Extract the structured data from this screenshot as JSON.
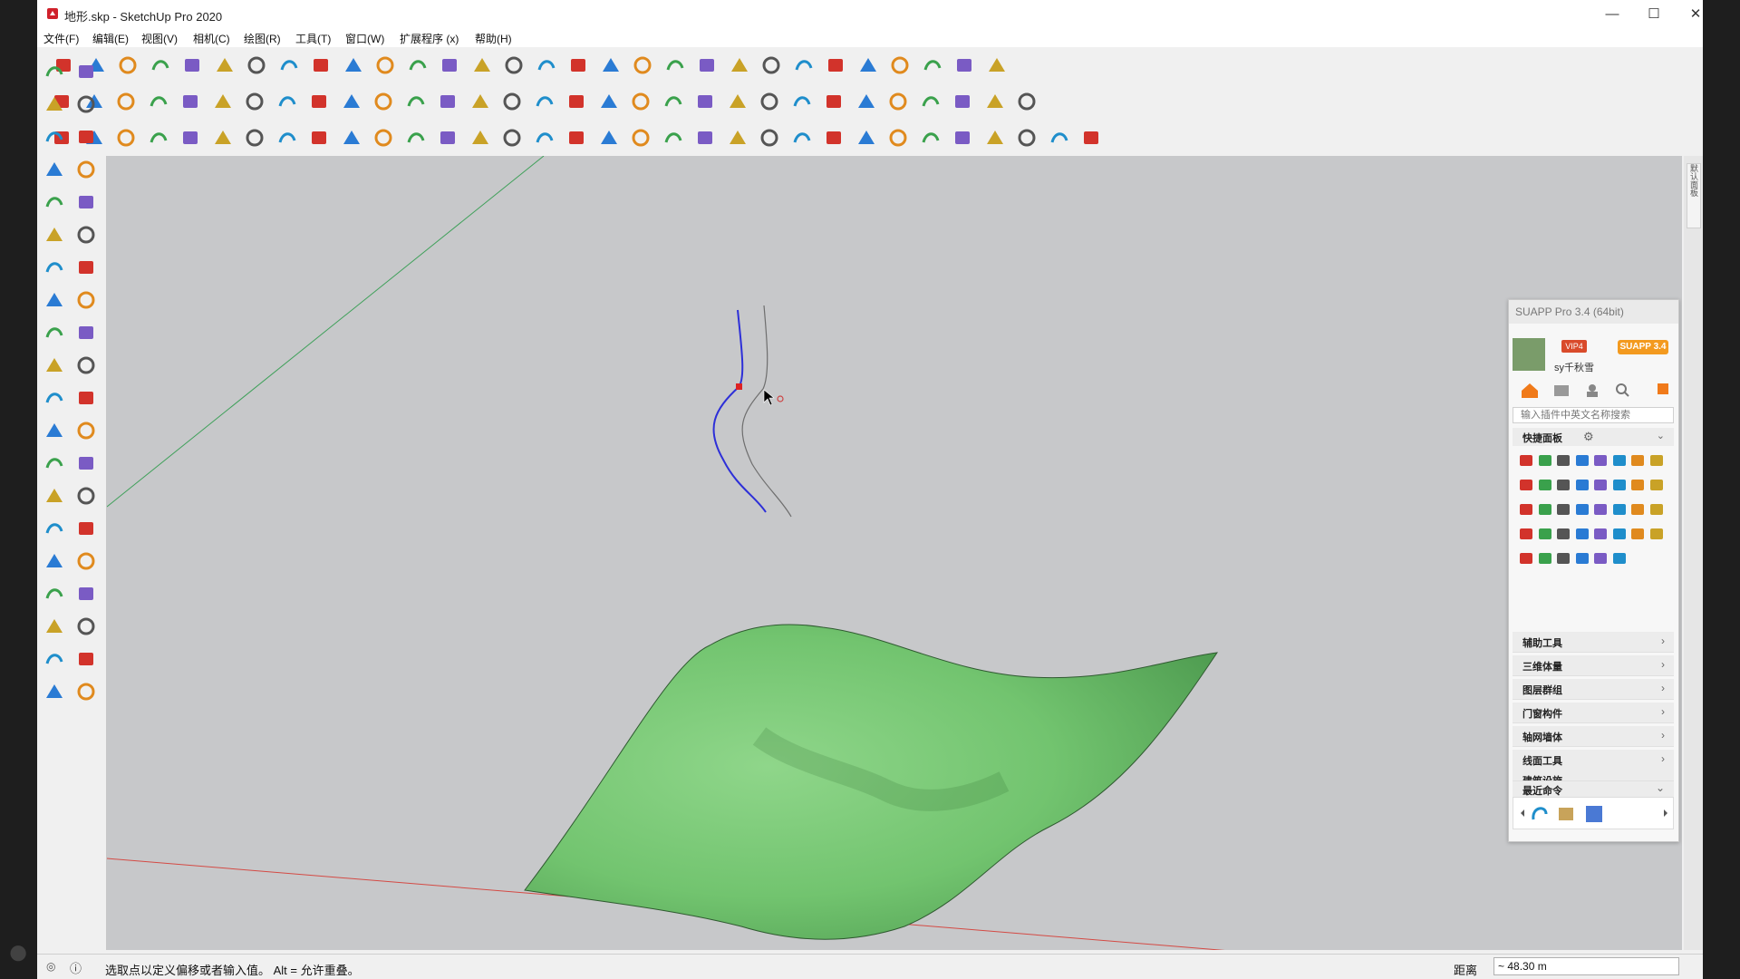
{
  "window": {
    "title": "地形.skp - SketchUp Pro 2020",
    "minimize": "—",
    "maximize": "☐",
    "close": "✕"
  },
  "menu": [
    "文件(F)",
    "编辑(E)",
    "视图(V)",
    "相机(C)",
    "绘图(R)",
    "工具(T)",
    "窗口(W)",
    "扩展程序 (x)",
    "帮助(H)"
  ],
  "toolbars": {
    "row1": [
      "new",
      "open",
      "save",
      "cut",
      "copy",
      "paste",
      "erase",
      "undo",
      "redo",
      "print",
      "model-info",
      "x-ray",
      "back-edges",
      "wireframe",
      "hidden-line",
      "shaded",
      "textured",
      "iso",
      "top",
      "front",
      "right",
      "back",
      "left",
      "bottom",
      "section",
      "section-fill",
      "section-cut",
      "display-sections",
      "sun",
      "scenes"
    ],
    "row2": [
      "push-pull",
      "offset",
      "follow-me",
      "sandbox",
      "texture",
      "eraser",
      "rotate",
      "scale",
      "move",
      "array",
      "plane",
      "mirror",
      "tape",
      "protractor",
      "axes",
      "dimension",
      "text",
      "3d-text",
      "paint",
      "flip",
      "weld",
      "subdivide",
      "smooth",
      "shape-bender",
      "curviloft",
      "joint-push-pull",
      "extrude",
      "round-corner",
      "solid-tools",
      "components",
      "layers"
    ],
    "row3": [
      "warehouse",
      "share",
      "import",
      "export",
      "print-preview",
      "styles",
      "component-options",
      "materials",
      "view-gallery",
      "shadow",
      "fog",
      "soften",
      "outliner",
      "tags",
      "layout",
      "match-photo",
      "instructor",
      "geo",
      "arc-2pt",
      "arc-3pt",
      "freehand",
      "bezier",
      "polyline",
      "circle",
      "ellipse",
      "spiral",
      "helix",
      "catenary",
      "offset-curve",
      "trim",
      "extend",
      "fillet",
      "polygon"
    ]
  },
  "left_tools": [
    "select",
    "make-component",
    "paint-bucket",
    "eraser",
    "pencil",
    "freehand",
    "rectangle",
    "rotated-rectangle",
    "circle",
    "polygon",
    "arc",
    "pie",
    "2pt-arc",
    "3pt-arc",
    "move",
    "push-pull",
    "rotate",
    "follow-me",
    "scale",
    "offset",
    "tape-measure",
    "dimensions",
    "protractor",
    "text",
    "axes",
    "3d-text",
    "orbit",
    "pan",
    "zoom",
    "zoom-window",
    "zoom-extents",
    "previous",
    "position-camera",
    "look-around",
    "walk",
    "section-plane",
    "warehouse",
    "extension-warehouse",
    "send-to-layout",
    "extension-manager"
  ],
  "right_tab": "默认面板",
  "suapp": {
    "title": "SUAPP Pro 3.4 (64bit)",
    "user": "sy千秋雪",
    "vip": "VIP4",
    "badge": "SUAPP 3.4",
    "search_placeholder": "输入插件中英文名称搜索",
    "panel_label": "快捷面板",
    "categories": [
      "辅助工具",
      "三维体量",
      "图层群组",
      "门窗构件",
      "轴网墙体",
      "线面工具",
      "建筑设施"
    ],
    "recent_label": "最近命令",
    "nav_icons": [
      "home-icon",
      "list-icon",
      "user-icon",
      "search-icon",
      "grid-icon"
    ]
  },
  "status": {
    "hint": "选取点以定义偏移或者输入值。 Alt = 允许重叠。",
    "measure_label": "距离",
    "measure_value": "~ 48.30 m"
  },
  "colors": {
    "viewport_bg": "#c7c8ca",
    "terrain": "#7fcb7c",
    "terrain_dark": "#55a357",
    "blue_curve": "#2d2fd8",
    "grey_curve": "#6e6e6e",
    "red_axis": "#d44a44",
    "green_axis": "#3fa05a",
    "accent": "#f39a1f"
  }
}
